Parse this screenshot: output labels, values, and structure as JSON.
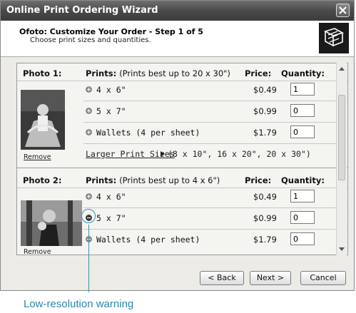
{
  "window": {
    "title": "Online Print Ordering Wizard"
  },
  "header": {
    "title": "Ofoto: Customize Your Order - Step 1 of 5",
    "subtitle": "Choose print sizes and quantities."
  },
  "columns": {
    "prints": "Prints:",
    "price": "Price:",
    "quantity": "Quantity:"
  },
  "photos": [
    {
      "label": "Photo 1:",
      "prints_note": "(Prints best up to 20 x 30\")",
      "remove": "Remove",
      "rows": [
        {
          "size": "4 x 6\"",
          "price": "$0.49",
          "qty": "1"
        },
        {
          "size": "5 x 7\"",
          "price": "$0.99",
          "qty": "0"
        },
        {
          "size": "Wallets (4 per sheet)",
          "price": "$1.79",
          "qty": "0"
        }
      ],
      "larger_link": "Larger Print Sizes",
      "larger_extra": "(8 x 10\", 16 x 20\", 20 x 30\")"
    },
    {
      "label": "Photo 2:",
      "prints_note": "(Prints best up to 4 x 6\")",
      "remove": "Remove",
      "rows": [
        {
          "size": "4 x 6\"",
          "price": "$0.49",
          "qty": "1"
        },
        {
          "size": "5 x 7\"",
          "price": "$0.99",
          "qty": "0"
        },
        {
          "size": "Wallets (4 per sheet)",
          "price": "$1.79",
          "qty": "0"
        }
      ]
    }
  ],
  "buttons": {
    "back": "< Back",
    "next": "Next >",
    "cancel": "Cancel"
  },
  "annotation": {
    "text": "Low-resolution warning"
  }
}
